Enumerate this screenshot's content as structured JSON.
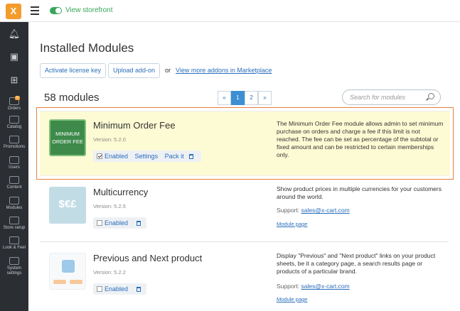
{
  "topbar": {
    "logo": "X",
    "storefront": "View storefront"
  },
  "sidebar": {
    "items": [
      {
        "label": "Orders",
        "badge": "8"
      },
      {
        "label": "Catalog"
      },
      {
        "label": "Promotions"
      },
      {
        "label": "Users"
      },
      {
        "label": "Content"
      },
      {
        "label": "Modules"
      },
      {
        "label": "Store setup"
      },
      {
        "label": "Look & Feel"
      },
      {
        "label": "System settings"
      }
    ]
  },
  "page": {
    "title": "Installed Modules",
    "activate_btn": "Activate license key",
    "upload_btn": "Upload add-on",
    "or": "or",
    "market_link": "View more addons in Marketplace",
    "count": "58 modules",
    "pager": {
      "prev": "«",
      "p1": "1",
      "p2": "2",
      "next": "»"
    },
    "search_placeholder": "Search for modules"
  },
  "modules": [
    {
      "name": "Minimum Order Fee",
      "icon_text_1": "MINIMUM",
      "icon_text_2": "ORDER FEE",
      "version": "Version: 5.2.0",
      "enabled": "Enabled",
      "settings": "Settings",
      "pack": "Pack it",
      "description": "The Minimum Order Fee module allows admin to set minimum purchase on orders and charge a fee if this limit is not reached. The fee can be set as percentage of the subtotal or fixed amount and can be restricted to certain memberships only."
    },
    {
      "name": "Multicurrency",
      "icon_text": "$€£",
      "version": "Version: 5.2.5",
      "enabled": "Enabled",
      "description": "Show product prices in multiple currencies for your customers around the world.",
      "support_label": "Support:",
      "support_email": "sales@x-cart.com",
      "module_page": "Module page"
    },
    {
      "name": "Previous and Next product",
      "version": "Version: 5.2.2",
      "enabled": "Enabled",
      "description": "Display \"Previous\" and \"Next product\" links on your product sheets, be it a category page, a search results page or products of a particular brand.",
      "support_label": "Support:",
      "support_email": "sales@x-cart.com",
      "module_page": "Module page"
    }
  ],
  "colors": {
    "accent": "#2a6ebb",
    "highlight_border": "#e77f3b",
    "highlight_bg": "#fdfbd4",
    "sidebar": "#2b2e33",
    "green": "#37a65a"
  }
}
